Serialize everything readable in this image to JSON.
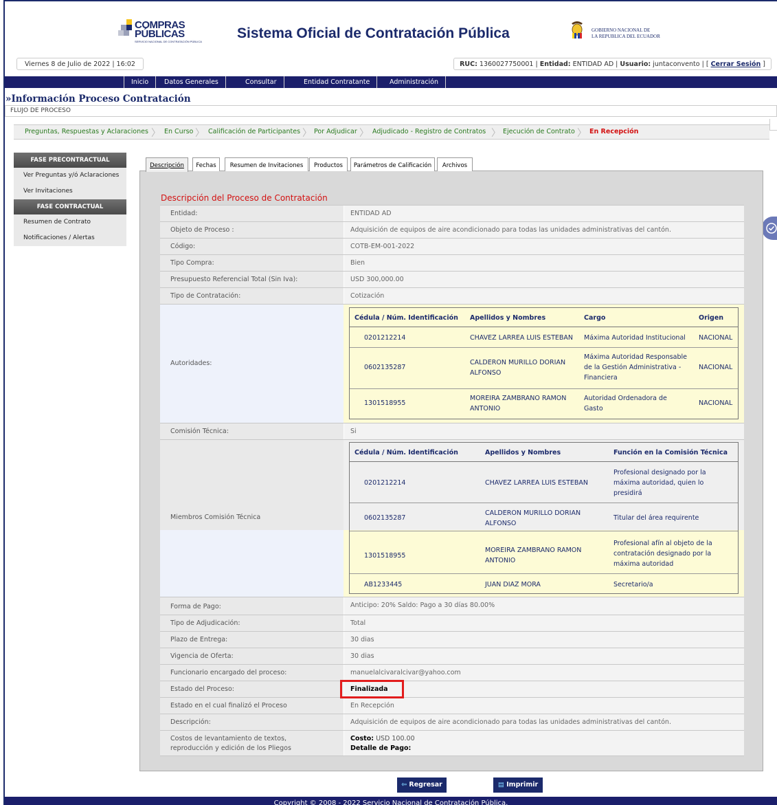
{
  "header": {
    "logo_line1": "COMPRAS",
    "logo_line2": "PÚBLICAS",
    "logo_tagline": "SERVICIO NACIONAL DE CONTRATACIÓN PÚBLICA",
    "site_title": "Sistema Oficial de Contratación Pública",
    "gob_line1": "GOBIERNO NACIONAL DE",
    "gob_line2": "LA REPUBLICA DEL ECUADOR"
  },
  "infobar": {
    "date": "Viernes 8 de Julio de 2022 | 16:02",
    "ruc_label": "RUC:",
    "ruc_value": "1360027750001",
    "entidad_label": "Entidad:",
    "entidad_value": "ENTIDAD AD",
    "usuario_label": "Usuario:",
    "usuario_value": "juntaconvento",
    "logout_open": "[",
    "logout": "Cerrar Sesión",
    "logout_close": "]"
  },
  "nav": [
    "Inicio",
    "Datos Generales",
    "Consultar",
    "Entidad Contratante",
    "Administración"
  ],
  "page_title": "»Información Proceso Contratación",
  "flow_label": "FLUJO DE PROCESO",
  "flow_steps": [
    "Preguntas, Respuestas y Aclaraciones",
    "En Curso",
    "Calificación de Participantes",
    "Por Adjudicar",
    "Adjudicado - Registro de Contratos",
    "Ejecución de Contrato",
    "En Recepción"
  ],
  "sidebar": {
    "header1": "FASE PRECONTRACTUAL",
    "items1": [
      "Ver Preguntas y/ó Aclaraciones",
      "Ver Invitaciones"
    ],
    "header2": "FASE CONTRACTUAL",
    "items2": [
      "Resumen de Contrato",
      "Notificaciones / Alertas"
    ]
  },
  "tabs": [
    "Descripción",
    "Fechas",
    "Resumen de Invitaciones",
    "Productos",
    "Parámetros de Calificación",
    "Archivos"
  ],
  "section_title": "Descripción del Proceso de Contratación",
  "fields": {
    "entidad": {
      "label": "Entidad:",
      "value": "ENTIDAD AD"
    },
    "objeto": {
      "label": "Objeto de Proceso :",
      "value": "Adquisición de equipos de aire acondicionado para todas las unidades administrativas del cantón."
    },
    "codigo": {
      "label": "Código:",
      "value": "COTB-EM-001-2022"
    },
    "tipo_compra": {
      "label": "Tipo Compra:",
      "value": "Bien"
    },
    "presupuesto": {
      "label": "Presupuesto Referencial Total (Sin Iva):",
      "value": "USD 300,000.00"
    },
    "tipo_contratacion": {
      "label": "Tipo de Contratación:",
      "value": "Cotización"
    },
    "autoridades_label": "Autoridades:",
    "comision_tecnica": {
      "label": "Comisión Técnica:",
      "value": "Si"
    },
    "miembros_label": "Miembros Comisión Técnica",
    "forma_pago": {
      "label": "Forma de Pago:",
      "value": "Anticipo: 20% Saldo: Pago a 30 días 80.00%"
    },
    "tipo_adjudicacion": {
      "label": "Tipo de Adjudicación:",
      "value": "Total"
    },
    "plazo_entrega": {
      "label": "Plazo de Entrega:",
      "value": "30 dias"
    },
    "vigencia_oferta": {
      "label": "Vigencia de Oferta:",
      "value": "30 dias"
    },
    "funcionario": {
      "label": "Funcionario encargado del proceso:",
      "value": "manuelalcivaralcivar@yahoo.com"
    },
    "estado_proceso": {
      "label": "Estado del Proceso:",
      "value": "Finalizada"
    },
    "estado_finalizo": {
      "label": "Estado en el cual finalizó el Proceso",
      "value": "En Recepción"
    },
    "descripcion": {
      "label": "Descripción:",
      "value": "Adquisición de equipos de aire acondicionado para todas las unidades administrativas del cantón."
    },
    "costos": {
      "label_line1": "Costos de levantamiento de textos,",
      "label_line2": "reproducción y edición de los Pliegos",
      "costo_label": "Costo:",
      "costo_value": "USD 100.00",
      "detalle_label": "Detalle de Pago:"
    }
  },
  "autoridades": {
    "headers": [
      "Cédula / Núm. Identificación",
      "Apellidos y Nombres",
      "Cargo",
      "Origen"
    ],
    "rows": [
      {
        "cedula": "0201212214",
        "nombre": "CHAVEZ LARREA LUIS ESTEBAN",
        "cargo": "Máxima Autoridad Institucional",
        "origen": "NACIONAL"
      },
      {
        "cedula": "0602135287",
        "nombre": "CALDERON MURILLO DORIAN ALFONSO",
        "cargo": "Máxima Autoridad Responsable de la Gestión Administrativa - Financiera",
        "origen": "NACIONAL"
      },
      {
        "cedula": "1301518955",
        "nombre": "MOREIRA ZAMBRANO RAMON ANTONIO",
        "cargo": "Autoridad Ordenadora de Gasto",
        "origen": "NACIONAL"
      }
    ]
  },
  "miembros": {
    "headers": [
      "Cédula / Núm. Identificación",
      "Apellidos y Nombres",
      "Función en la Comisión Técnica"
    ],
    "rows": [
      {
        "cedula": "0201212214",
        "nombre": "CHAVEZ LARREA LUIS ESTEBAN",
        "funcion": "Profesional designado por la máxima autoridad, quien lo presidirá"
      },
      {
        "cedula": "0602135287",
        "nombre": "CALDERON MURILLO DORIAN ALFONSO",
        "funcion": "Titular del área requirente"
      },
      {
        "cedula": "1301518955",
        "nombre": "MOREIRA ZAMBRANO RAMON ANTONIO",
        "funcion": "Profesional afín al objeto de la contratación designado por la máxima autoridad"
      },
      {
        "cedula": "AB1233445",
        "nombre": "JUAN DIAZ MORA",
        "funcion": "Secretario/a"
      }
    ]
  },
  "buttons": {
    "back": "Regresar",
    "print": "Imprimir"
  },
  "footer": "Copyright © 2008 - 2022 Servicio Nacional de Contratación Pública.",
  "colors": {
    "navy": "#1b1f6b",
    "red": "#d31111",
    "green": "#2a7a1f",
    "yellow": "#fdfbd6"
  }
}
